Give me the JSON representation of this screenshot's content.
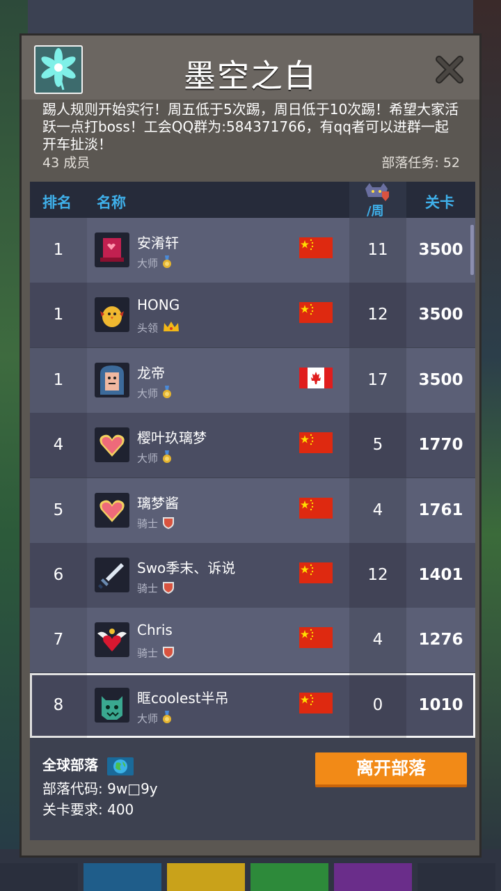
{
  "clan": {
    "name": "墨空之白",
    "notice": "踢人规则开始实行！周五低于5次踢，周日低于10次踢！希望大家活跃一点打boss！工会QQ群为:584371766，有qq者可以进群一起开车扯淡！",
    "members": "43 成员",
    "tasks": "部落任务: 52"
  },
  "table": {
    "headers": {
      "rank": "排名",
      "name": "名称",
      "week": "/周",
      "level": "关卡"
    },
    "rows": [
      {
        "rank": "1",
        "name": "安淆轩",
        "role": "大师",
        "role_icon": "medal-icon",
        "country": "CN",
        "week": "11",
        "level": "3500",
        "avatar": "hat-avatar-icon"
      },
      {
        "rank": "1",
        "name": "HONG",
        "role": "头领",
        "role_icon": "crown-icon",
        "country": "CN",
        "week": "12",
        "level": "3500",
        "avatar": "chick-avatar-icon"
      },
      {
        "rank": "1",
        "name": "龙帝",
        "role": "大师",
        "role_icon": "medal-icon",
        "country": "CA",
        "week": "17",
        "level": "3500",
        "avatar": "hooded-avatar-icon"
      },
      {
        "rank": "4",
        "name": "樱叶玖璃梦",
        "role": "大师",
        "role_icon": "medal-icon",
        "country": "CN",
        "week": "5",
        "level": "1770",
        "avatar": "heart-avatar-icon"
      },
      {
        "rank": "5",
        "name": "璃梦酱",
        "role": "骑士",
        "role_icon": "shield-icon",
        "country": "CN",
        "week": "4",
        "level": "1761",
        "avatar": "heart-avatar-icon"
      },
      {
        "rank": "6",
        "name": "Swo季末、诉说",
        "role": "骑士",
        "role_icon": "shield-icon",
        "country": "CN",
        "week": "12",
        "level": "1401",
        "avatar": "sword-avatar-icon"
      },
      {
        "rank": "7",
        "name": "Chris",
        "role": "骑士",
        "role_icon": "shield-icon",
        "country": "CN",
        "week": "4",
        "level": "1276",
        "avatar": "winged-heart-avatar-icon"
      },
      {
        "rank": "8",
        "name": "眶coolest半吊",
        "role": "大师",
        "role_icon": "medal-icon",
        "country": "CN",
        "week": "0",
        "level": "1010",
        "avatar": "monster-avatar-icon"
      }
    ]
  },
  "footer": {
    "global": "全球部落",
    "code": "部落代码: 9w□9y",
    "requirement": "关卡要求:  400",
    "leave_button": "离开部落"
  },
  "colors": {
    "accent_blue": "#3fb0ea",
    "button_orange": "#f28a17",
    "flag_red": "#de2910",
    "flag_yellow": "#ffde00"
  }
}
